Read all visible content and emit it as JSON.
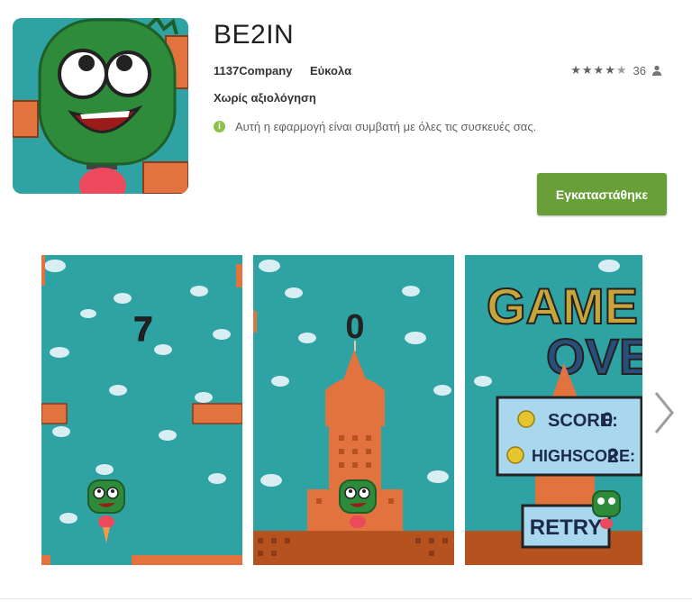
{
  "app": {
    "title": "BE2IN",
    "developer": "1137Company",
    "category": "Εύκολα",
    "rating_count": "36",
    "content_rating": "Χωρίς αξιολόγηση",
    "compatibility": "Αυτή η εφαρμογή είναι συμβατή με όλες τις συσκευές σας.",
    "install_label": "Εγκαταστάθηκε",
    "stars": "4.5 of 5",
    "star_full": "★★★★",
    "star_half": "★"
  },
  "screenshots": [
    {
      "score_text": "7"
    },
    {
      "score_text": "0"
    },
    {
      "game_over_line1": "GAME",
      "game_over_line2": "OVER",
      "score_label": "SCORE:",
      "score_value": "0",
      "highscore_label": "HIGHSCORE:",
      "highscore_value": "2",
      "retry_label": "RETRY"
    }
  ],
  "colors": {
    "accent_green": "#689f38",
    "info_green": "#8bc34a",
    "game_teal": "#2fa3a3",
    "brick": "#e2733f",
    "character_green": "#2e8b3a"
  },
  "icons": [
    "info-icon",
    "person-icon",
    "chevron-right-icon",
    "star-icon"
  ]
}
